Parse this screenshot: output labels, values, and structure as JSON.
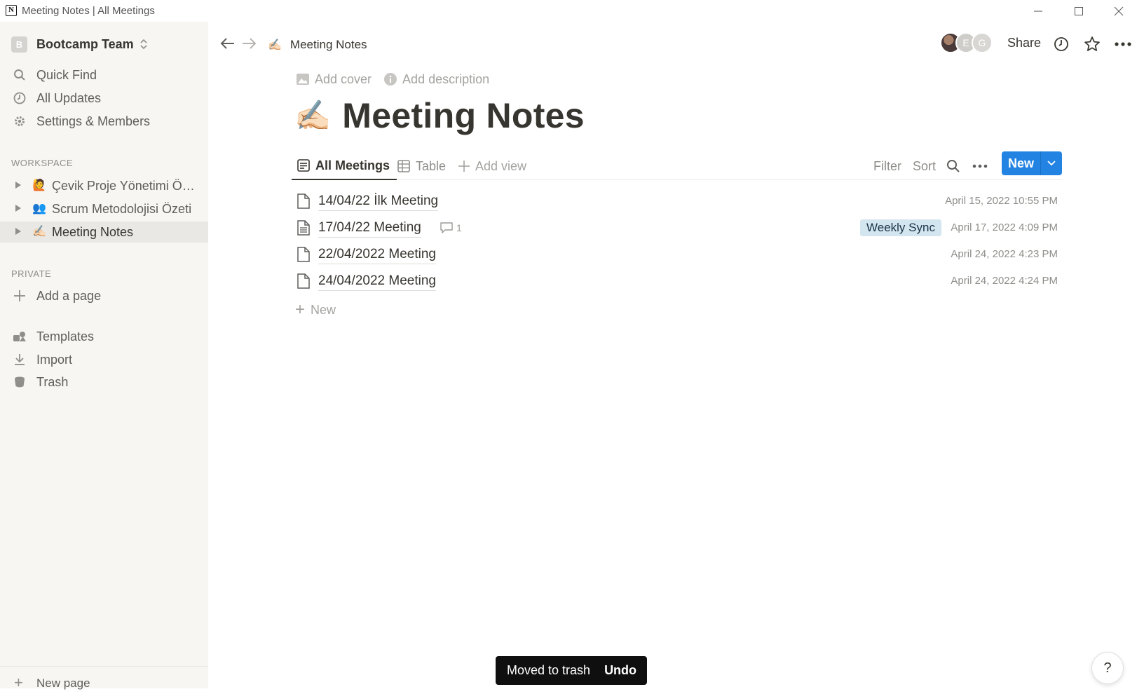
{
  "window": {
    "title": "Meeting Notes | All Meetings"
  },
  "sidebar": {
    "workspace_badge": "B",
    "workspace_name": "Bootcamp Team",
    "nav": [
      {
        "label": "Quick Find",
        "icon": "search-icon"
      },
      {
        "label": "All Updates",
        "icon": "clock-icon"
      },
      {
        "label": "Settings & Members",
        "icon": "gear-icon"
      }
    ],
    "workspace_section": "WORKSPACE",
    "workspace_pages": [
      {
        "emoji": "🙋",
        "label": "Çevik Proje Yönetimi Özeti"
      },
      {
        "emoji": "👥",
        "label": "Scrum Metodolojisi Özeti"
      },
      {
        "emoji": "✍🏻",
        "label": "Meeting Notes"
      }
    ],
    "private_section": "PRIVATE",
    "add_page": "Add a page",
    "utilities": [
      {
        "label": "Templates",
        "icon": "templates-icon"
      },
      {
        "label": "Import",
        "icon": "download-icon"
      },
      {
        "label": "Trash",
        "icon": "trash-icon"
      }
    ],
    "new_page": "New page"
  },
  "topbar": {
    "page_emoji": "✍🏻",
    "page_title": "Meeting Notes",
    "avatars": [
      "E",
      "G"
    ],
    "share_label": "Share"
  },
  "page": {
    "add_cover": "Add cover",
    "add_description": "Add description",
    "emoji": "✍🏻",
    "title": "Meeting Notes"
  },
  "views": {
    "tabs": [
      "All Meetings",
      "Table"
    ],
    "add_view": "Add view",
    "filter": "Filter",
    "sort": "Sort",
    "new_label": "New"
  },
  "rows": [
    {
      "name": "14/04/22 İlk Meeting",
      "date": "April 15, 2022 10:55 PM"
    },
    {
      "name": "17/04/22 Meeting",
      "comments": "1",
      "tag": "Weekly Sync",
      "date": "April 17, 2022 4:09 PM"
    },
    {
      "name": "22/04/2022 Meeting",
      "date": "April 24, 2022 4:23 PM"
    },
    {
      "name": "24/04/2022 Meeting",
      "date": "April 24, 2022 4:24 PM"
    }
  ],
  "add_row_label": "New",
  "toast": {
    "message": "Moved to trash",
    "action": "Undo"
  },
  "help_label": "?",
  "colors": {
    "accent": "#2383e2",
    "sidebar_bg": "#f7f6f3",
    "tag_bg": "#d3e5ef",
    "text": "#37352f"
  }
}
